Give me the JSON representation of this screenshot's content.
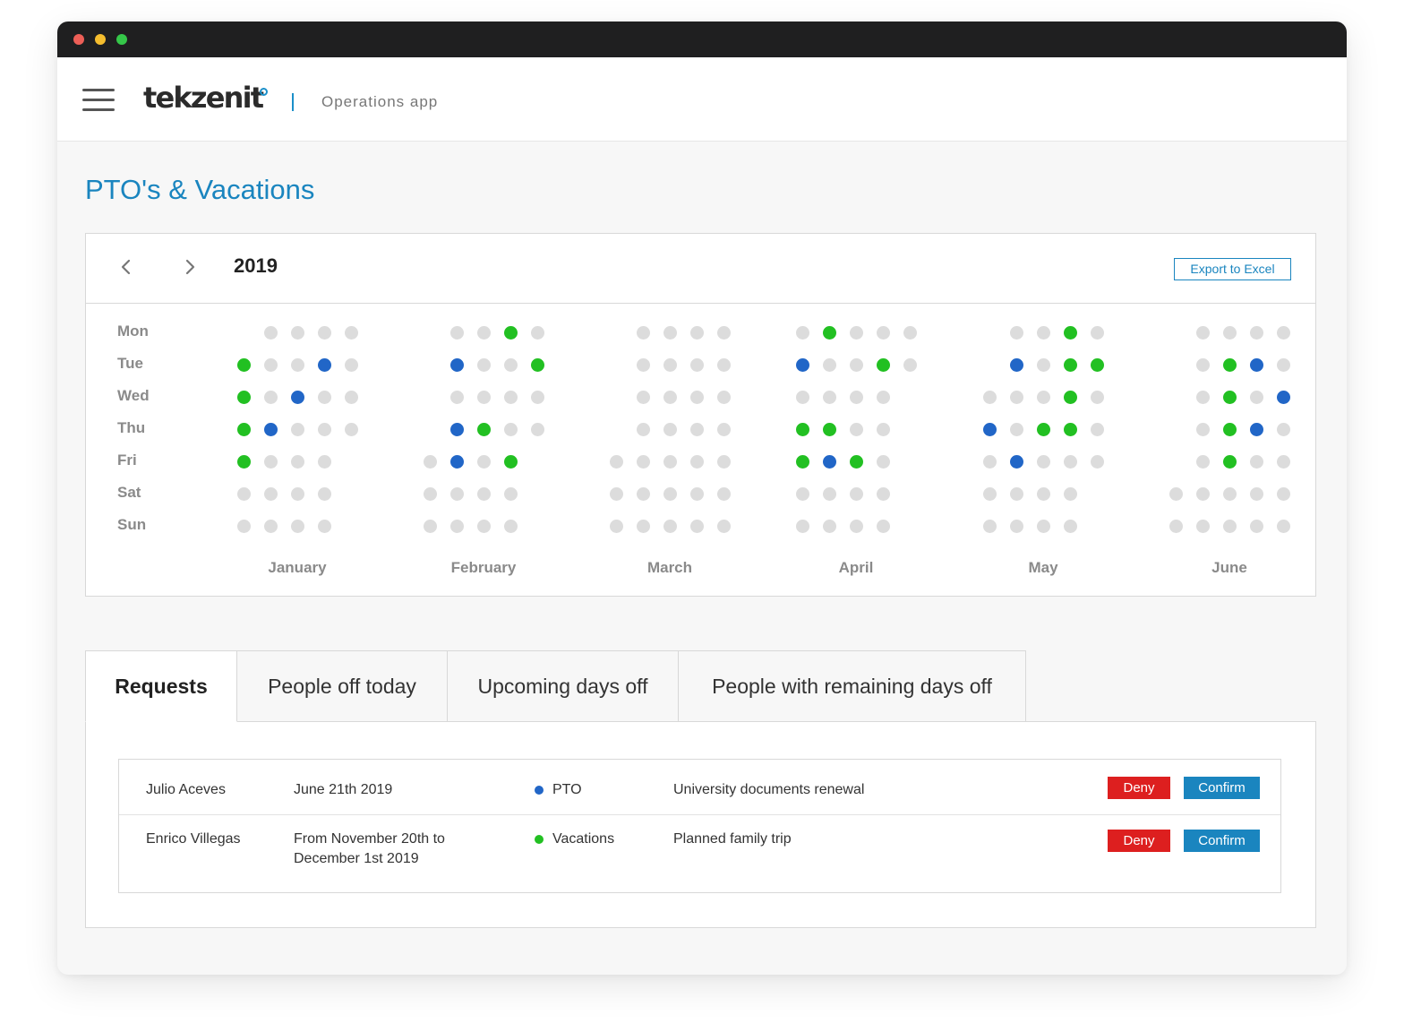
{
  "header": {
    "brand": "tekzenit",
    "app_name": "Operations app"
  },
  "page": {
    "title": "PTO's & Vacations"
  },
  "calendar": {
    "year": "2019",
    "export_label": "Export to Excel",
    "days": [
      "Mon",
      "Tue",
      "Wed",
      "Thu",
      "Fri",
      "Sat",
      "Sun"
    ],
    "legend_colors": {
      "off": "#dcdcdc",
      "vacation": "#22c022",
      "pto": "#2166c7"
    },
    "months": [
      {
        "name": "January",
        "grid": [
          "_0000",
          "v00p0",
          "v0p00",
          "vp000",
          "v000_",
          "0000_",
          "0000_"
        ]
      },
      {
        "name": "February",
        "grid": [
          "_00v0",
          "_p00v",
          "_0000",
          "_pv00",
          "0p0v_",
          "0000_",
          "0000_"
        ]
      },
      {
        "name": "March",
        "grid": [
          "_0000",
          "_0000",
          "_0000",
          "_0000",
          "00000",
          "00000",
          "00000"
        ]
      },
      {
        "name": "April",
        "grid": [
          "0v000",
          "p00v0",
          "0000_",
          "vv00_",
          "vpv0_",
          "0000_",
          "0000_"
        ]
      },
      {
        "name": "May",
        "grid": [
          "_00v0",
          "_p0vv",
          "000v0",
          "p0vv0",
          "0p000",
          "0000_",
          "0000_"
        ]
      },
      {
        "name": "June",
        "grid": [
          "_0000",
          "_0vp0",
          "_0v0p",
          "_0vp0",
          "_0v00",
          "00000",
          "00000"
        ]
      }
    ]
  },
  "tabs": [
    {
      "label": "Requests",
      "active": true
    },
    {
      "label": "People off today",
      "active": false
    },
    {
      "label": "Upcoming days off",
      "active": false
    },
    {
      "label": "People with remaining days off",
      "active": false
    }
  ],
  "requests": [
    {
      "name": "Julio Aceves",
      "date_line1": "June 21th 2019",
      "date_line2": "",
      "type": "PTO",
      "type_color": "#2166c7",
      "reason": "University documents renewal",
      "deny_label": "Deny",
      "confirm_label": "Confirm"
    },
    {
      "name": "Enrico Villegas",
      "date_line1": "From November 20th to",
      "date_line2": "December 1st 2019",
      "type": "Vacations",
      "type_color": "#22c022",
      "reason": "Planned family trip",
      "deny_label": "Deny",
      "confirm_label": "Confirm"
    }
  ],
  "icons": {
    "menu": "hamburger-menu-icon",
    "prev": "chevron-left-icon",
    "next": "chevron-right-icon"
  }
}
